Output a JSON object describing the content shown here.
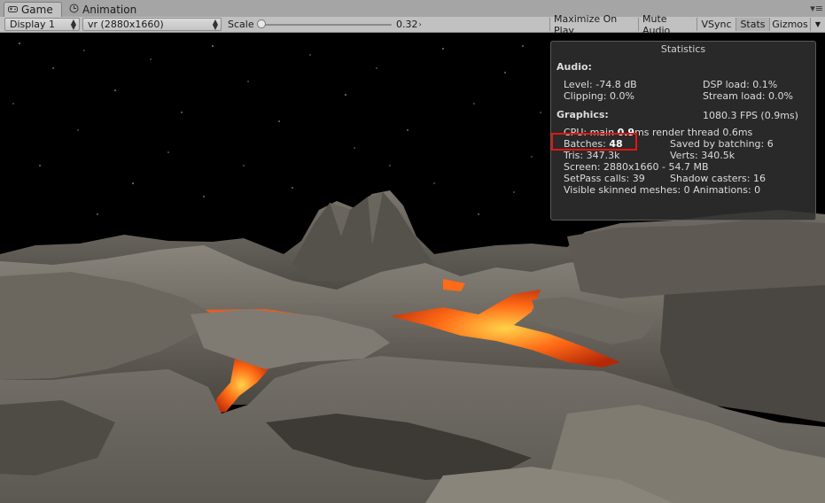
{
  "tabs": [
    {
      "label": "Game",
      "icon": "game-icon"
    },
    {
      "label": "Animation",
      "icon": "animation-icon"
    }
  ],
  "toolbar": {
    "display": "Display 1",
    "resolution": "vr (2880x1660)",
    "scale_label": "Scale",
    "scale_value": "0.32",
    "buttons": [
      "Maximize On Play",
      "Mute Audio",
      "VSync",
      "Stats",
      "Gizmos"
    ]
  },
  "stats": {
    "title": "Statistics",
    "audio": {
      "header": "Audio:",
      "level": "Level: -74.8 dB",
      "clipping": "Clipping: 0.0%",
      "dsp_load": "DSP load: 0.1%",
      "stream_load": "Stream load: 0.0%"
    },
    "graphics": {
      "header": "Graphics:",
      "fps": "1080.3 FPS (0.9ms)",
      "cpu_prefix": "CPU: main ",
      "cpu_main": "0.9",
      "cpu_suffix": "ms  render thread 0.6ms",
      "batches_label": "Batches: ",
      "batches_value": "48",
      "saved_by_batching": "Saved by batching: 6",
      "tris": "Tris: 347.3k",
      "verts": "Verts: 340.5k",
      "screen": "Screen: 2880x1660 - 54.7 MB",
      "setpass": "SetPass calls: 39",
      "shadow_casters": "Shadow casters: 16",
      "skinned_meshes": "Visible skinned meshes: 0  Animations: 0"
    }
  },
  "colors": {
    "highlight": "#e01616",
    "lava": "#ff5a14",
    "rock": "#6e6a63"
  }
}
